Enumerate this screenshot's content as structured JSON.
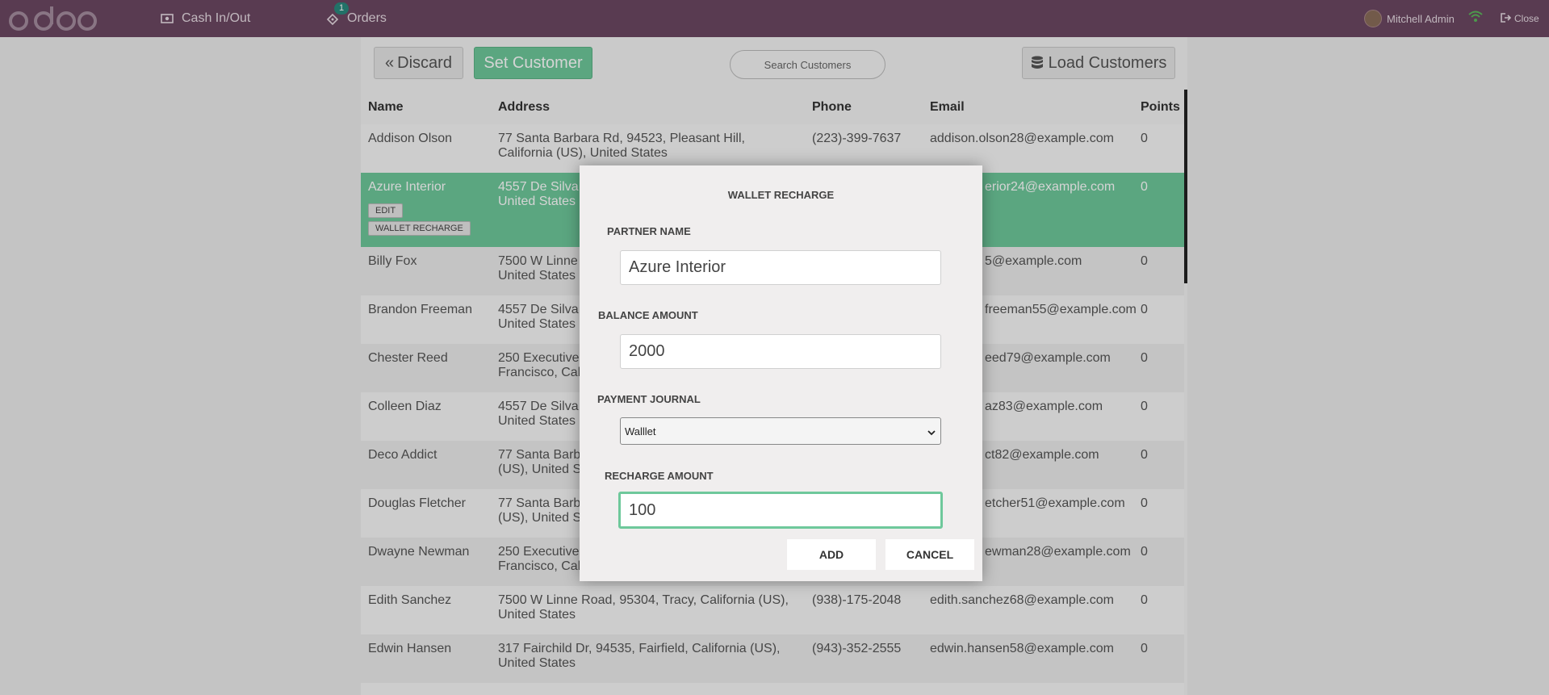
{
  "navbar": {
    "logo_text": "odoo",
    "cash_label": "Cash In/Out",
    "orders_label": "Orders",
    "orders_badge": "1",
    "user_name": "Mitchell Admin",
    "close_label": "Close"
  },
  "toolbar": {
    "discard_label": "Discard",
    "set_customer_label": "Set Customer",
    "search_placeholder": "Search Customers",
    "load_customers_label": "Load Customers"
  },
  "table": {
    "headers": {
      "name": "Name",
      "address": "Address",
      "phone": "Phone",
      "email": "Email",
      "points": "Points"
    },
    "rows": [
      {
        "name": "Addison Olson",
        "address": "77 Santa Barbara Rd, 94523, Pleasant Hill, California (US), United States",
        "phone": "(223)-399-7637",
        "email": "addison.olson28@example.com",
        "points": "0"
      },
      {
        "name": "Azure Interior",
        "address": "4557 De Silva\nUnited States",
        "phone": "",
        "email": "erior24@example.com",
        "points": "0",
        "edit_label": "EDIT",
        "wallet_label": "WALLET RECHARGE"
      },
      {
        "name": "Billy Fox",
        "address": "7500 W Linne\nUnited States",
        "phone": "",
        "email": "5@example.com",
        "points": "0"
      },
      {
        "name": "Brandon Freeman",
        "address": "4557 De Silva\nUnited States",
        "phone": "",
        "email": "freeman55@example.com",
        "points": "0"
      },
      {
        "name": "Chester Reed",
        "address": "250 Executive\nFrancisco, Cali",
        "phone": "",
        "email": "eed79@example.com",
        "points": "0"
      },
      {
        "name": "Colleen Diaz",
        "address": "4557 De Silva\nUnited States",
        "phone": "",
        "email": "az83@example.com",
        "points": "0"
      },
      {
        "name": "Deco Addict",
        "address": "77 Santa Barba\n(US), United S",
        "phone": "",
        "email": "ct82@example.com",
        "points": "0"
      },
      {
        "name": "Douglas Fletcher",
        "address": "77 Santa Barba\n(US), United S",
        "phone": "",
        "email": "etcher51@example.com",
        "points": "0"
      },
      {
        "name": "Dwayne Newman",
        "address": "250 Executive\nFrancisco, Cali",
        "phone": "",
        "email": "ewman28@example.com",
        "points": "0"
      },
      {
        "name": "Edith Sanchez",
        "address": "7500 W Linne Road, 95304, Tracy, California (US), United States",
        "phone": "(938)-175-2048",
        "email": "edith.sanchez68@example.com",
        "points": "0"
      },
      {
        "name": "Edwin Hansen",
        "address": "317 Fairchild Dr, 94535, Fairfield, California (US), United States",
        "phone": "(943)-352-2555",
        "email": "edwin.hansen58@example.com",
        "points": "0"
      }
    ]
  },
  "modal": {
    "title": "WALLET RECHARGE",
    "partner_label": "PARTNER NAME",
    "partner_value": "Azure Interior",
    "balance_label": "BALANCE AMOUNT",
    "balance_value": "2000",
    "journal_label": "PAYMENT JOURNAL",
    "journal_selected": "Walllet",
    "recharge_label": "RECHARGE AMOUNT",
    "recharge_value": "100",
    "add_label": "ADD",
    "cancel_label": "CANCEL"
  },
  "colors": {
    "navbar": "#6b4762",
    "accent_green": "#6ec89b"
  }
}
